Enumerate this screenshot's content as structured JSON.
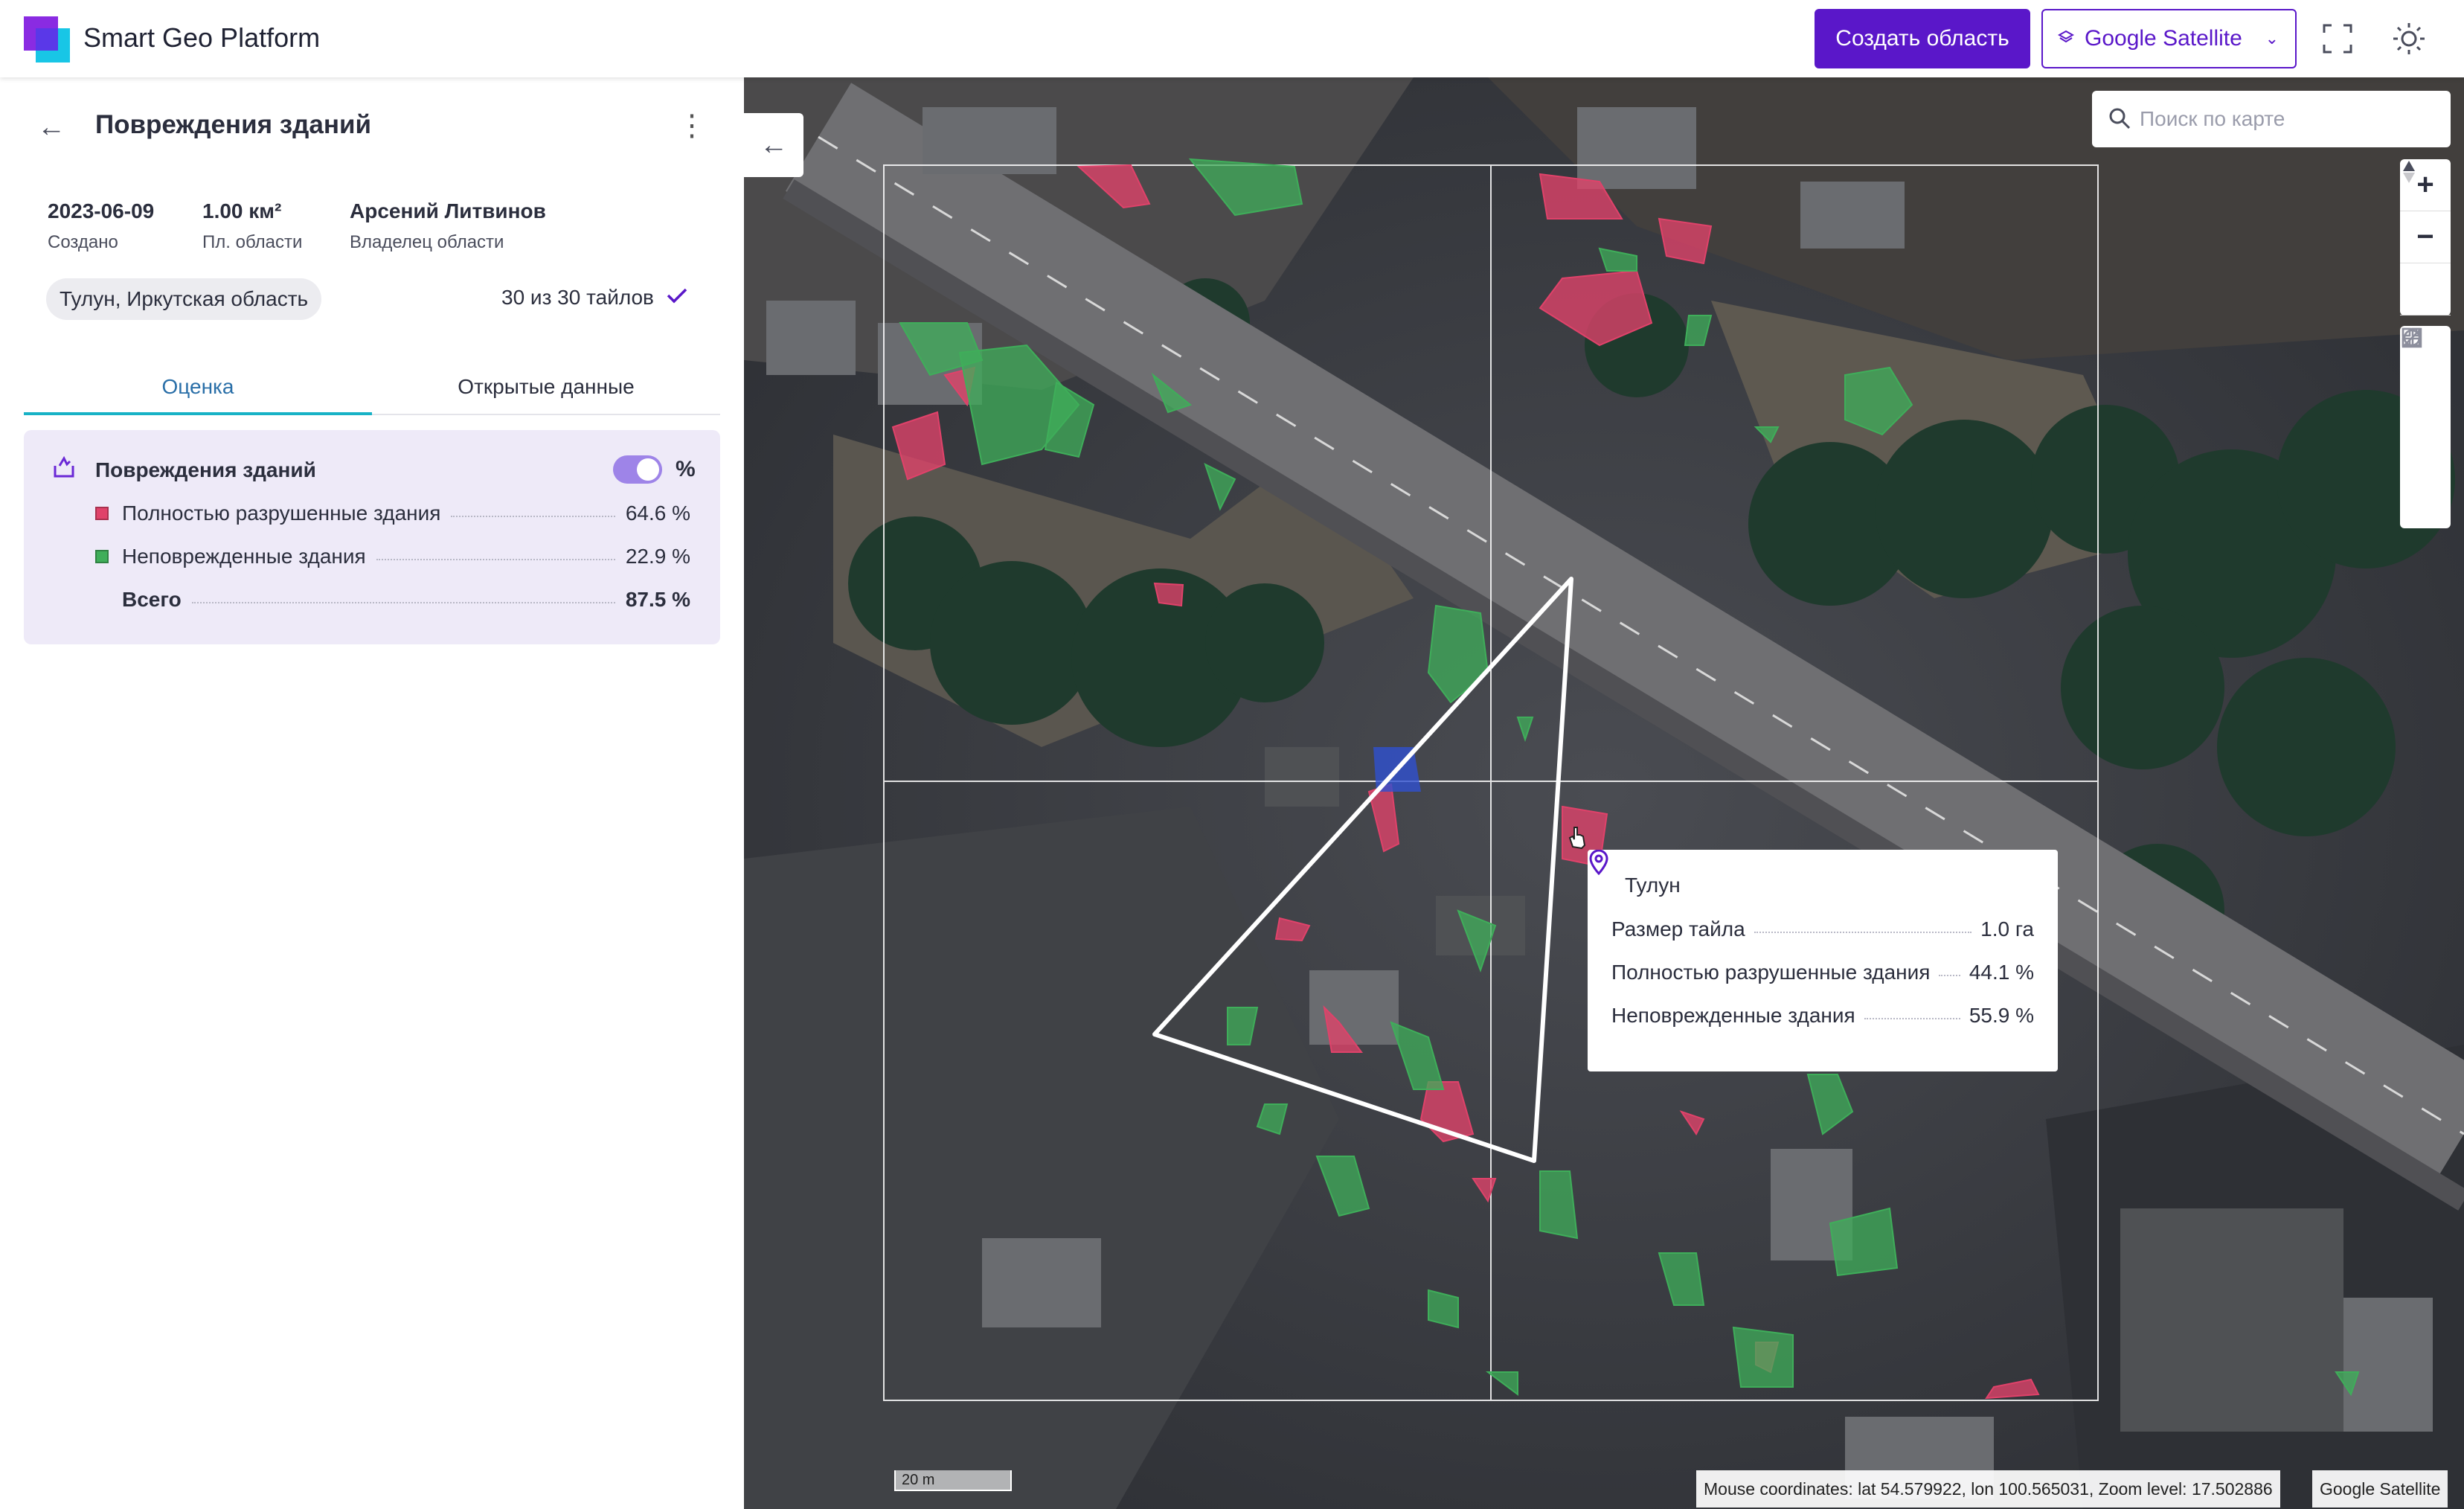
{
  "app": {
    "title": "Smart Geo Platform"
  },
  "header": {
    "create_label": "Создать область",
    "layer_label": "Google Satellite"
  },
  "sidebar": {
    "title": "Повреждения зданий",
    "meta": [
      {
        "value": "2023-06-09",
        "label": "Создано"
      },
      {
        "value": "1.00 км²",
        "label": "Пл. области"
      },
      {
        "value": "Арсений Литвинов",
        "label": "Владелец области"
      }
    ],
    "location": "Тулун, Иркутская область",
    "tiles": "30 из 30 тайлов",
    "tabs": [
      "Оценка",
      "Открытые данные"
    ],
    "card": {
      "title": "Повреждения зданий",
      "unit": "%",
      "toggle_on": true,
      "rows": [
        {
          "name": "Полностью разрушенные здания",
          "value": "64.6 %",
          "color": "#e0426a"
        },
        {
          "name": "Неповрежденные здания",
          "value": "22.9 %",
          "color": "#3fae5a"
        }
      ],
      "total": {
        "name": "Всего",
        "value": "87.5 %"
      }
    }
  },
  "map": {
    "search_placeholder": "Поиск по карте",
    "popup": {
      "place": "Тулун",
      "rows": [
        {
          "name": "Размер тайла",
          "value": "1.0 га"
        },
        {
          "name": "Полностью разрушенные здания",
          "value": "44.1 %"
        },
        {
          "name": "Неповрежденные здания",
          "value": "55.9 %"
        }
      ]
    },
    "scale_label": "20 m",
    "coords": "Mouse coordinates: lat 54.579922, lon 100.565031, Zoom level: 17.502886",
    "attribution": "Google Satellite",
    "colors": {
      "destroyed": "#e0426a",
      "intact": "#3fae5a"
    }
  }
}
